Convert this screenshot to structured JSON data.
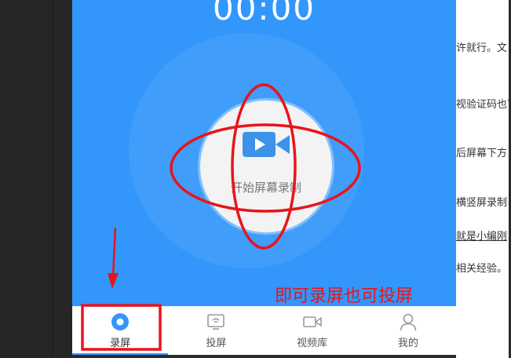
{
  "timer": "00:00",
  "record_button": {
    "label": "开始屏幕录制",
    "icon": "video-camera-icon"
  },
  "nav": {
    "items": [
      {
        "label": "录屏",
        "icon": "record-dot-icon",
        "active": true
      },
      {
        "label": "投屏",
        "icon": "cast-screen-icon",
        "active": false
      },
      {
        "label": "视频库",
        "icon": "video-library-icon",
        "active": false
      },
      {
        "label": "我的",
        "icon": "profile-icon",
        "active": false
      }
    ]
  },
  "annotation": {
    "text": "即可录屏也可投屏",
    "color": "#e8141c"
  },
  "document_fragments": [
    "许就行。文",
    "视验证码也可",
    "后屏幕下方",
    "横竖屏录制",
    "就是小编刚",
    "相关经验。"
  ],
  "colors": {
    "accent": "#3296fa",
    "annotation": "#e8141c"
  }
}
